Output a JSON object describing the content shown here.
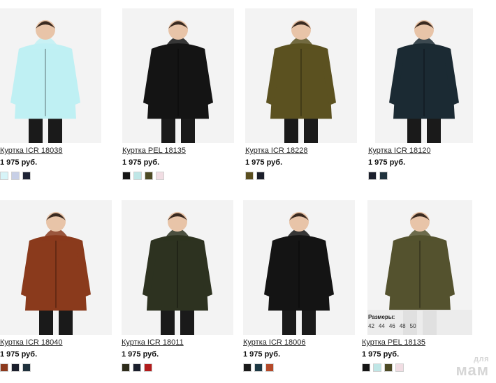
{
  "products": [
    {
      "title": "Куртка ICR 18038",
      "price": "1 975 руб.",
      "colors": [
        "#d7f4f8",
        "#c7cfe6",
        "#1f2436"
      ]
    },
    {
      "title": "Куртка PEL 18135",
      "price": "1 975 руб.",
      "colors": [
        "#151515",
        "#bfe6e6",
        "#4d4a24",
        "#f1dde3"
      ]
    },
    {
      "title": "Куртка ICR 18228",
      "price": "1 975 руб.",
      "colors": [
        "#5a4e1f",
        "#1c1f2b"
      ]
    },
    {
      "title": "Куртка ICR 18120",
      "price": "1 975 руб.",
      "colors": [
        "#1b1f2c",
        "#20323d"
      ]
    },
    {
      "title": "Куртка ICR 18040",
      "price": "1 975 руб.",
      "colors": [
        "#8c3a1e",
        "#1b1f2c",
        "#20323d"
      ]
    },
    {
      "title": "Куртка ICR 18011",
      "price": "1 975 руб.",
      "colors": [
        "#2e2c1b",
        "#1b1f2c",
        "#b21c1c"
      ]
    },
    {
      "title": "Куртка ICR 18006",
      "price": "1 975 руб.",
      "colors": [
        "#1a1a1a",
        "#1e3a45",
        "#b54a2a"
      ]
    },
    {
      "title": "Куртка PEL 18135",
      "price": "1 975 руб.",
      "colors": [
        "#151515",
        "#bfe6e6",
        "#4d4a24",
        "#f1dde3"
      ]
    }
  ],
  "sizes_panel": {
    "title": "Размеры:",
    "sizes": [
      "42",
      "44",
      "46",
      "48",
      "50"
    ]
  },
  "watermark": {
    "top": "для",
    "bottom": "мам"
  },
  "jacket_colors": [
    "#bff0f3",
    "#141414",
    "#5b5120",
    "#1b2a33",
    "#8a3a1c",
    "#2d3220",
    "#141414",
    "#54522e"
  ]
}
